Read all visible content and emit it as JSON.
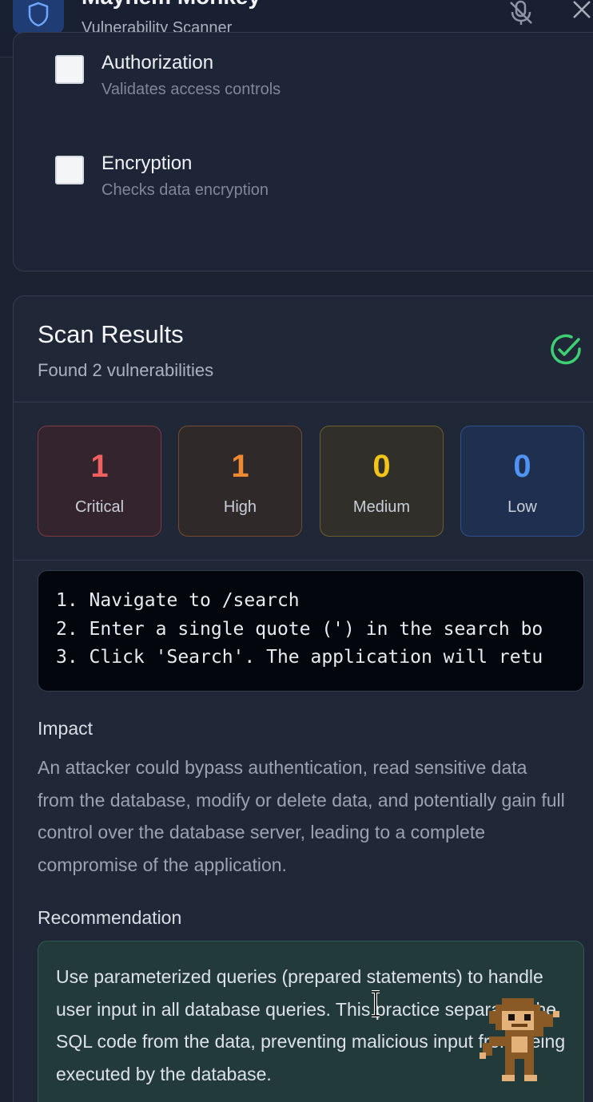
{
  "header": {
    "app_title": "Mayhem Monkey",
    "app_subtitle": "Vulnerability Scanner",
    "logo_icon": "shield-icon",
    "mic_icon": "mic-off-icon",
    "close_icon": "close-icon"
  },
  "scan_types": {
    "items": [
      {
        "title": "Authorization",
        "description": "Validates access controls",
        "checked": false
      },
      {
        "title": "Encryption",
        "description": "Checks data encryption",
        "checked": false
      }
    ]
  },
  "results": {
    "title": "Scan Results",
    "subtitle": "Found 2 vulnerabilities",
    "status_icon": "check-circle-icon",
    "severity": [
      {
        "count": "1",
        "label": "Critical",
        "color": "#f0605e"
      },
      {
        "count": "1",
        "label": "High",
        "color": "#f08a32"
      },
      {
        "count": "0",
        "label": "Medium",
        "color": "#f2c318"
      },
      {
        "count": "0",
        "label": "Low",
        "color": "#4f93f5"
      }
    ],
    "steps": [
      "1. Navigate to /search",
      "2. Enter a single quote (') in the search bo",
      "3. Click 'Search'. The application will retu"
    ],
    "impact_heading": "Impact",
    "impact_text": "An attacker could bypass authentication, read sensitive data from the database, modify or delete data, and potentially gain full control over the database server, leading to a complete compromise of the application.",
    "recommendation_heading": "Recommendation",
    "recommendation_text": "Use parameterized queries (prepared statements) to handle user input in all database queries. This practice separates the SQL code from the data, preventing malicious input from being executed by the database."
  },
  "colors": {
    "success": "#3ecf72",
    "accent": "#1f3c74"
  }
}
